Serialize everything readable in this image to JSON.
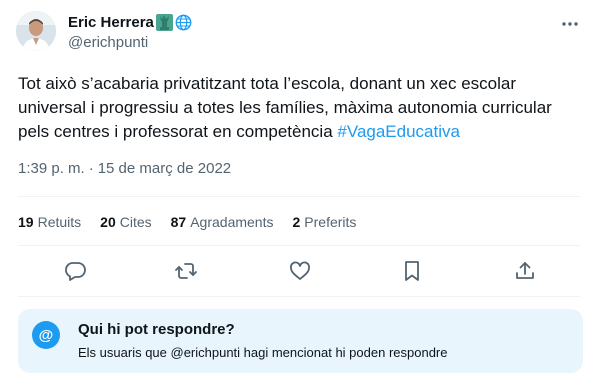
{
  "author": {
    "name": "Eric Herrera",
    "handle": "@erichpunti",
    "badges": [
      "statue-of-liberty-icon",
      "globe-icon"
    ]
  },
  "tweet": {
    "text": "Tot això s’acabaria privatitzant tota l’escola, donant un xec escolar universal i progressiu a totes les famílies, màxima autonomia curricular pels centres i professorat en competència",
    "hashtag": "#VagaEducativa",
    "time": "1:39 p. m.",
    "separator": "·",
    "date": "15 de març de 2022"
  },
  "stats": [
    {
      "count": "19",
      "label": "Retuits"
    },
    {
      "count": "20",
      "label": "Cites"
    },
    {
      "count": "87",
      "label": "Agradaments"
    },
    {
      "count": "2",
      "label": "Preferits"
    }
  ],
  "actions": [
    "reply-icon",
    "retweet-icon",
    "like-icon",
    "bookmark-icon",
    "share-icon"
  ],
  "reply_restriction": {
    "icon": "@",
    "title": "Qui hi pot respondre?",
    "subtitle": "Els usuaris que @erichpunti hagi mencionat hi poden respondre"
  },
  "colors": {
    "accent": "#1d9bf0",
    "muted": "#536471",
    "reply_box_bg": "#e8f5fd"
  }
}
